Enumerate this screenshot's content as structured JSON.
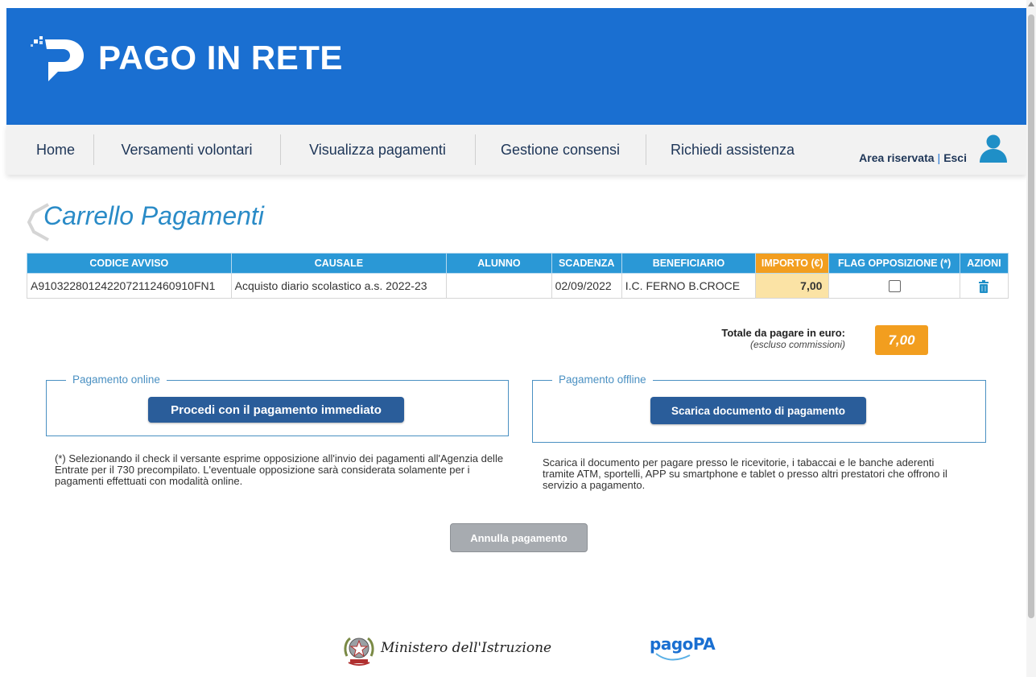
{
  "header": {
    "app_title": "PAGO IN RETE"
  },
  "nav": {
    "items": [
      "Home",
      "Versamenti volontari",
      "Visualizza pagamenti",
      "Gestione consensi",
      "Richiedi assistenza"
    ],
    "area_riservata": "Area riservata",
    "separator": "|",
    "esci": "Esci"
  },
  "page_title": "Carrello Pagamenti",
  "table": {
    "headers": [
      "CODICE AVVISO",
      "CAUSALE",
      "ALUNNO",
      "SCADENZA",
      "BENEFICIARIO",
      "IMPORTO (€)",
      "FLAG OPPOSIZIONE (*)",
      "AZIONI"
    ],
    "rows": [
      {
        "codice": "A9103228012422072112460910FN1",
        "causale": "Acquisto diario scolastico a.s. 2022-23",
        "alunno": "",
        "scadenza": "02/09/2022",
        "beneficiario": "I.C. FERNO B.CROCE",
        "importo": "7,00",
        "flag_opposizione": false
      }
    ]
  },
  "totale": {
    "label": "Totale da pagare in euro:",
    "sublabel": "(escluso commissioni)",
    "value": "7,00"
  },
  "online": {
    "legend": "Pagamento online",
    "button": "Procedi con il pagamento immediato",
    "note": "(*) Selezionando il check il versante esprime opposizione all'invio dei pagamenti all'Agenzia delle Entrate per il 730 precompilato. L'eventuale opposizione sarà considerata solamente per i pagamenti effettuati con modalità online."
  },
  "offline": {
    "legend": "Pagamento offline",
    "button": "Scarica documento di pagamento",
    "note": "Scarica il documento per pagare presso le ricevitorie, i tabaccai e le banche aderenti tramite ATM, sportelli, APP su smartphone e tablet o presso altri prestatori che offrono il servizio a pagamento."
  },
  "annulla": "Annulla pagamento",
  "footer": {
    "ministero": "Ministero dell'Istruzione",
    "pagopa": "pagoPA"
  },
  "colors": {
    "header_blue": "#1a6fd1",
    "table_header": "#2a98d6",
    "importo_orange": "#f29e1f",
    "button_blue": "#2a5d9a"
  }
}
